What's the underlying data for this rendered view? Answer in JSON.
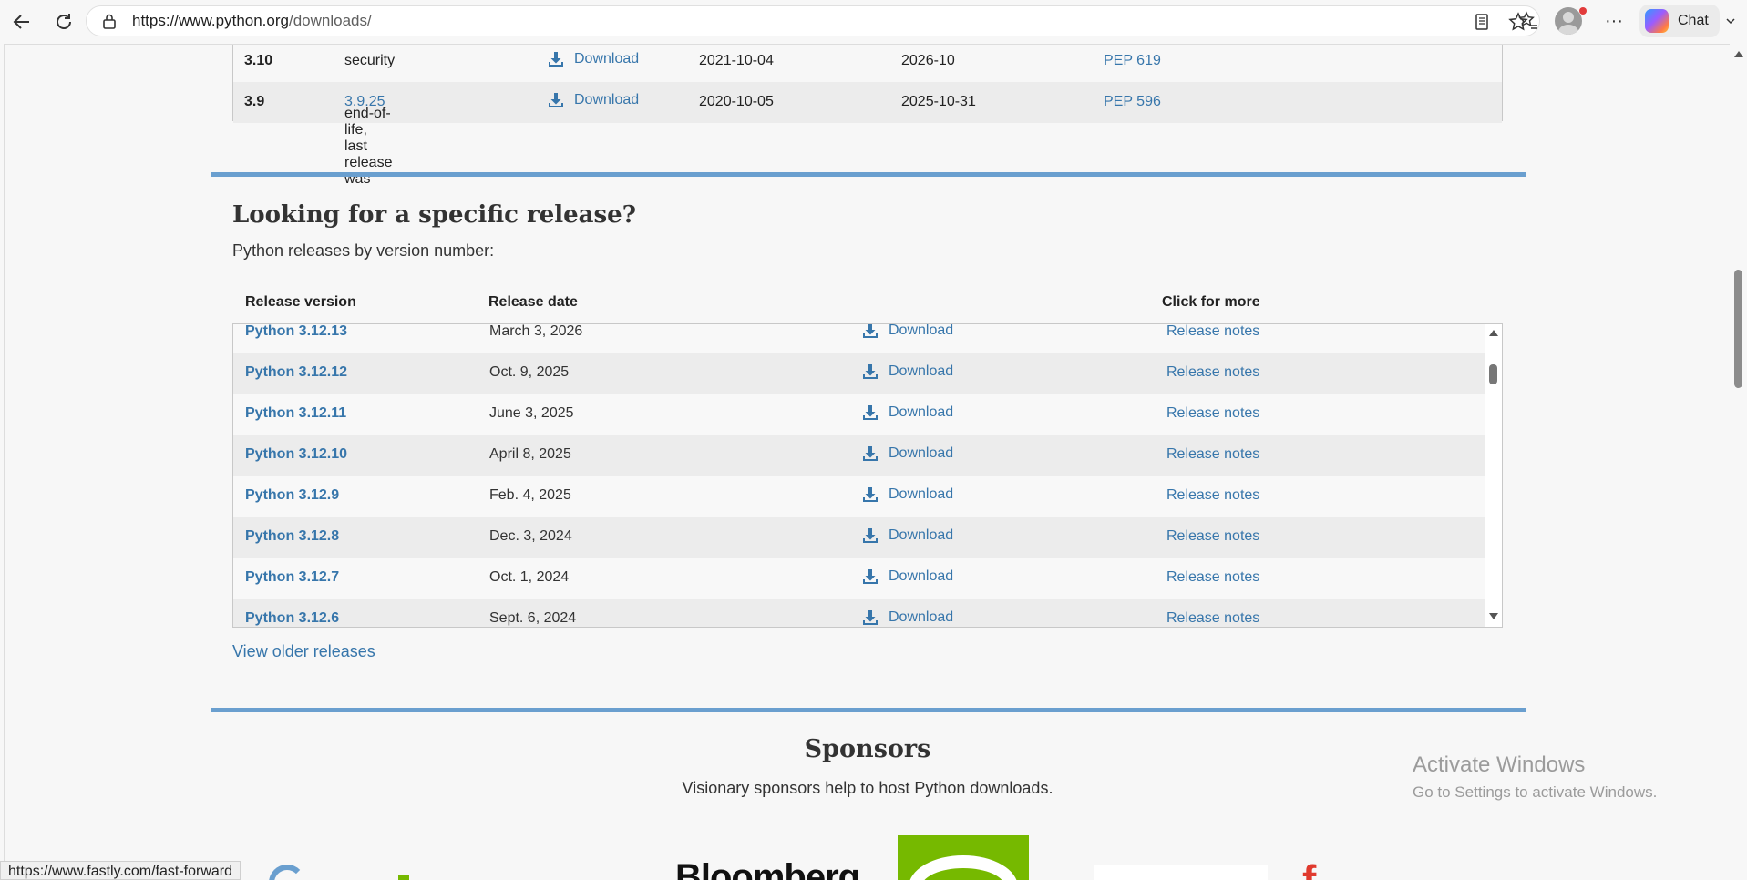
{
  "browser": {
    "url_host": "https://www.python.org",
    "url_path": "/downloads/",
    "chat_label": "Chat"
  },
  "top_table": {
    "rows": [
      {
        "version": "3.10",
        "status": "security",
        "status_link": "",
        "download": "Download",
        "released": "2021-10-04",
        "end": "2026-10",
        "pep": "PEP 619"
      },
      {
        "version": "3.9",
        "status": "end-of-life, last release was",
        "status_link": "3.9.25",
        "download": "Download",
        "released": "2020-10-05",
        "end": "2025-10-31",
        "pep": "PEP 596"
      }
    ]
  },
  "specific": {
    "title": "Looking for a specific release?",
    "subtitle": "Python releases by version number:",
    "headers": {
      "version": "Release version",
      "date": "Release date",
      "more": "Click for more"
    },
    "rows": [
      {
        "version": "Python 3.12.13",
        "date": "March 3, 2026",
        "download": "Download",
        "notes": "Release notes"
      },
      {
        "version": "Python 3.12.12",
        "date": "Oct. 9, 2025",
        "download": "Download",
        "notes": "Release notes"
      },
      {
        "version": "Python 3.12.11",
        "date": "June 3, 2025",
        "download": "Download",
        "notes": "Release notes"
      },
      {
        "version": "Python 3.12.10",
        "date": "April 8, 2025",
        "download": "Download",
        "notes": "Release notes"
      },
      {
        "version": "Python 3.12.9",
        "date": "Feb. 4, 2025",
        "download": "Download",
        "notes": "Release notes"
      },
      {
        "version": "Python 3.12.8",
        "date": "Dec. 3, 2024",
        "download": "Download",
        "notes": "Release notes"
      },
      {
        "version": "Python 3.12.7",
        "date": "Oct. 1, 2024",
        "download": "Download",
        "notes": "Release notes"
      },
      {
        "version": "Python 3.12.6",
        "date": "Sept. 6, 2024",
        "download": "Download",
        "notes": "Release notes"
      }
    ],
    "older_link": "View older releases"
  },
  "sponsors": {
    "title": "Sponsors",
    "subtitle": "Visionary sponsors help to host Python downloads.",
    "logos": [
      "Bloomberg"
    ]
  },
  "watermark": {
    "line1": "Activate Windows",
    "line2": "Go to Settings to activate Windows."
  },
  "status_bar": {
    "url": "https://www.fastly.com/fast-forward"
  },
  "colors": {
    "link": "#3776ab",
    "rule": "#6a9fcf"
  }
}
